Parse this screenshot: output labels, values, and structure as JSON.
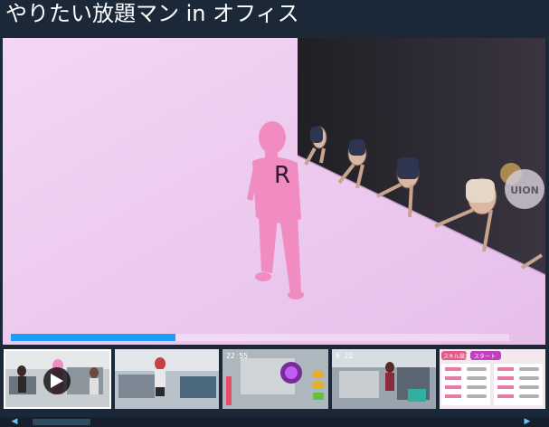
{
  "app": {
    "title": "やりたい放題マン in オフィス"
  },
  "media": {
    "overlay_badge": "UION",
    "progress_percent": 33,
    "accent_color": "#1a9fff"
  },
  "thumbnails": [
    {
      "name": "thumbnail-video",
      "selected": true,
      "has_play_icon": true
    },
    {
      "name": "thumbnail-office-1",
      "selected": false
    },
    {
      "name": "thumbnail-gameplay-ui",
      "selected": false
    },
    {
      "name": "thumbnail-office-2",
      "selected": false
    },
    {
      "name": "thumbnail-settings-menu",
      "selected": false
    }
  ],
  "thumbnail_texts": {
    "settings_title": "スキル設定",
    "settings_start": "スタート",
    "hud_time_1": "22 55",
    "hud_time_2": "6 22"
  },
  "icons": {
    "play": "play-icon",
    "scroll_left": "arrow-left-icon",
    "scroll_right": "arrow-right-icon"
  },
  "scroll": {
    "left_glyph": "◀",
    "right_glyph": "▶"
  }
}
